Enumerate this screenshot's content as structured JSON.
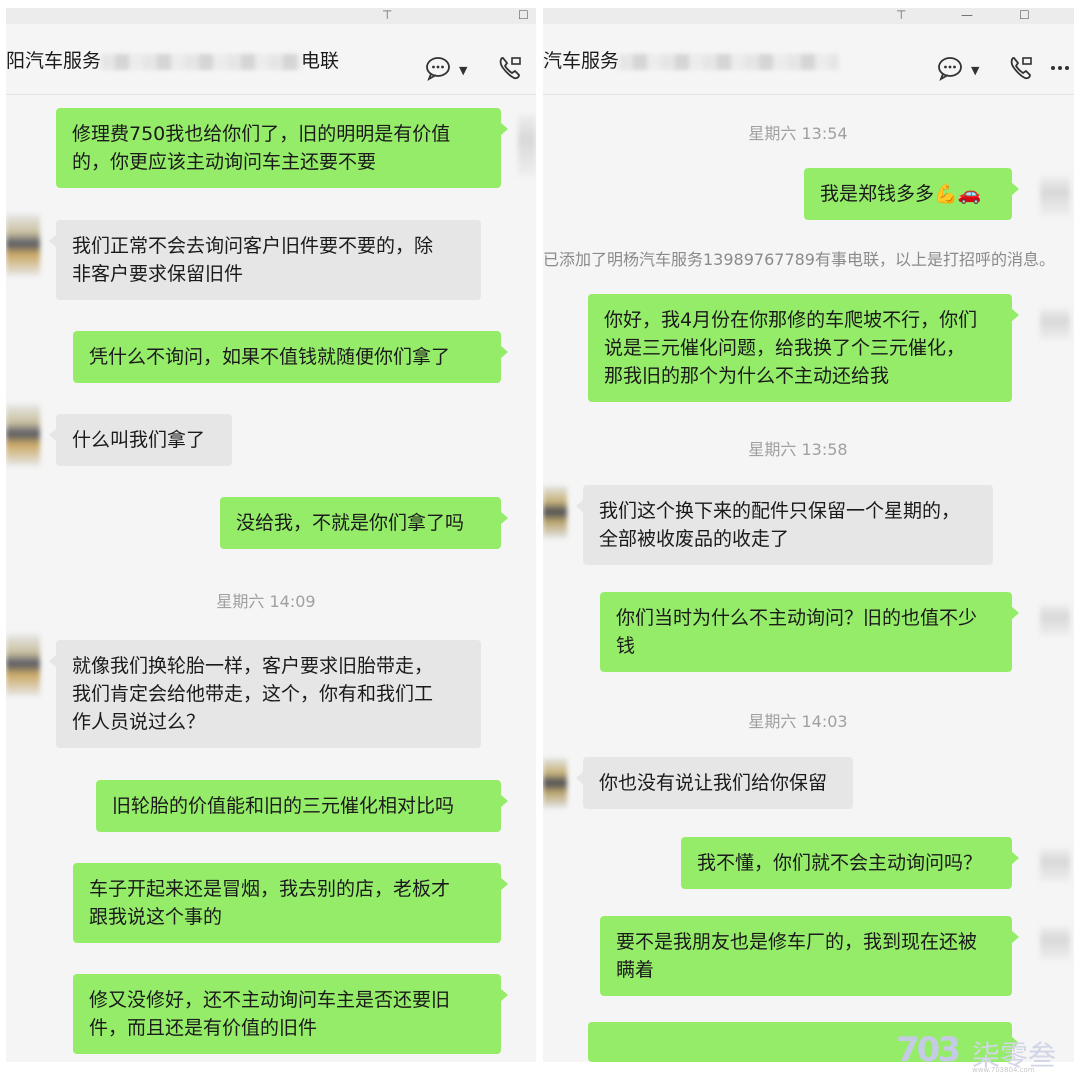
{
  "left": {
    "title_prefix": "阳汽车服务",
    "title_suffix": "电联",
    "messages": [
      {
        "dir": "out",
        "text": "修理费750我也给你们了，旧的明明是有价值\n的，你更应该主动询问车主还要不要"
      },
      {
        "dir": "in",
        "text": "我们正常不会去询问客户旧件要不要的，除\n非客户要求保留旧件"
      },
      {
        "dir": "out",
        "text": "凭什么不询问，如果不值钱就随便你们拿了"
      },
      {
        "dir": "in",
        "text": "什么叫我们拿了"
      },
      {
        "dir": "out",
        "text": "没给我，不就是你们拿了吗"
      },
      {
        "dir": "time",
        "text": "星期六 14:09"
      },
      {
        "dir": "in",
        "text": "就像我们换轮胎一样，客户要求旧胎带走，\n我们肯定会给他带走，这个，你有和我们工\n作人员说过么？"
      },
      {
        "dir": "out",
        "text": "旧轮胎的价值能和旧的三元催化相对比吗"
      },
      {
        "dir": "out",
        "text": "车子开起来还是冒烟，我去别的店，老板才\n跟我说这个事的"
      },
      {
        "dir": "out",
        "text": "修又没修好，还不主动询问车主是否还要旧\n件，而且还是有价值的旧件"
      }
    ]
  },
  "right": {
    "title_prefix": "汽车服务",
    "system_message": "已添加了明杨汽车服务13989767789有事电联，以上是打招呼的消息。",
    "messages": [
      {
        "dir": "time",
        "text": "星期六 13:54"
      },
      {
        "dir": "out",
        "text": "我是郑钱多多💪🚗"
      },
      {
        "dir": "out",
        "text": "你好，我4月份在你那修的车爬坡不行，你们\n说是三元催化问题，给我换了个三元催化，\n那我旧的那个为什么不主动还给我"
      },
      {
        "dir": "time",
        "text": "星期六 13:58"
      },
      {
        "dir": "in",
        "text": "我们这个换下来的配件只保留一个星期的，\n全部被收废品的收走了"
      },
      {
        "dir": "out",
        "text": "你们当时为什么不主动询问？旧的也值不少\n钱"
      },
      {
        "dir": "time",
        "text": "星期六 14:03"
      },
      {
        "dir": "in",
        "text": "你也没有说让我们给你保留"
      },
      {
        "dir": "out",
        "text": "我不懂，你们就不会主动询问吗？"
      },
      {
        "dir": "out",
        "text": "要不是我朋友也是修车厂的，我到现在还被\n瞒着"
      }
    ]
  },
  "window_controls": {
    "pin": "⊤",
    "minimize": "—",
    "maximize": "☐"
  },
  "header_icons": {
    "chat": "chat-bubble-icon",
    "call": "video-call-icon",
    "more": "more-icon"
  },
  "watermark": {
    "logo": "703",
    "name": "柒零叁",
    "url": "www.703804.com"
  },
  "colors": {
    "outgoing_bubble": "#95ec69",
    "incoming_bubble": "#e6e6e6",
    "background": "#f5f5f5"
  }
}
